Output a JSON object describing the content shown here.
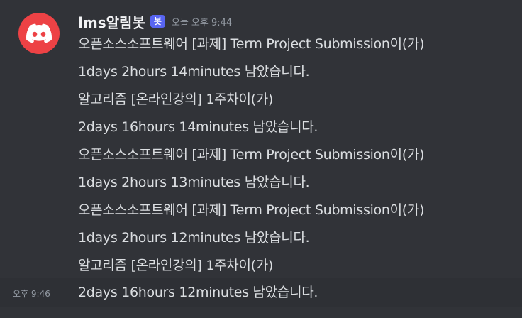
{
  "message": {
    "author": "lms알림봇",
    "bot_tag": "봇",
    "timestamp": "오늘 오후 9:44",
    "lines": [
      "오픈소스소프트웨어 [과제] Term Project Submission이(가)",
      "1days 2hours 14minutes 남았습니다.",
      "알고리즘 [온라인강의] 1주차이(가)",
      "2days 16hours 14minutes 남았습니다.",
      "오픈소스소프트웨어 [과제] Term Project Submission이(가)",
      "1days 2hours 13minutes 남았습니다.",
      "오픈소스소프트웨어 [과제] Term Project Submission이(가)",
      "1days 2hours 12minutes 남았습니다.",
      "알고리즘 [온라인강의] 1주차이(가)",
      "2days 16hours 12minutes 남았습니다."
    ],
    "hover_timestamp": "오후 9:46"
  },
  "icons": {
    "avatar": "discord-logo-icon"
  },
  "colors": {
    "background": "#313338",
    "avatar_bg": "#ed4245",
    "bot_tag_bg": "#5865f2",
    "text": "#dbdee1",
    "muted": "#949ba4"
  }
}
